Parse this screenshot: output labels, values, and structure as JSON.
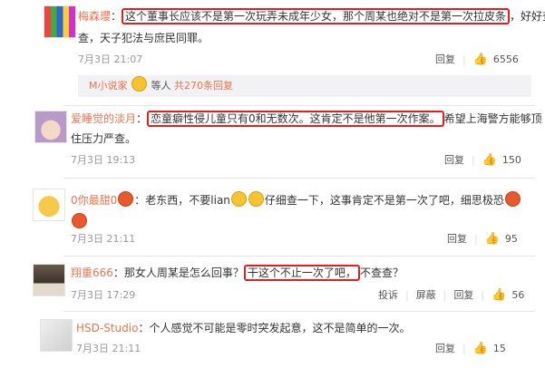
{
  "comments": [
    {
      "user": "梅森瓔",
      "highlight_1": "这个董事长应该不是第一次玩弄未成年少女，那个周某也绝对不是第一次拉皮条",
      "rest_1": "，好好查",
      "line2": "查，天子犯法与庶民同罪。",
      "time": "7月3日 21:07",
      "reply": "回复",
      "likes": "6556"
    },
    {
      "user": "爱睡觉的淡月",
      "highlight_1": "恋童癖性侵儿童只有0和无数次。这肯定不是他第一次作案。",
      "rest_1": "希望上海警方能够顶",
      "line2": "住压力严查。",
      "time": "7月3日 19:13",
      "reply": "回复",
      "likes": "150"
    },
    {
      "user": "0你最甜0",
      "prefix": "：老东西，不要lian",
      "middle": "仔细查一下，这事肯定不是第一次了吧，细思极恐",
      "time": "7月3日 21:11",
      "reply": "回复",
      "likes": "95"
    },
    {
      "user": "翔重666",
      "prefix": "：那女人周某是怎么回事？",
      "highlight": "干这个不止一次了吧，",
      "suffix": "不查查？",
      "time": "7月3日 17:29",
      "report": "投诉",
      "block": "屏蔽",
      "reply": "回复",
      "likes": "56"
    },
    {
      "user": "HSD-Studio",
      "body": "：个人感觉不可能是零时突发起意，这不是简单的一次。",
      "time": "7月3日 21:11",
      "reply": "回复",
      "likes": "15"
    }
  ],
  "summary": {
    "user": "M小说家",
    "rest": "等人",
    "link": "共270条回复"
  },
  "colors": {
    "username": "#eb7350",
    "highlight_border": "#e02020"
  }
}
